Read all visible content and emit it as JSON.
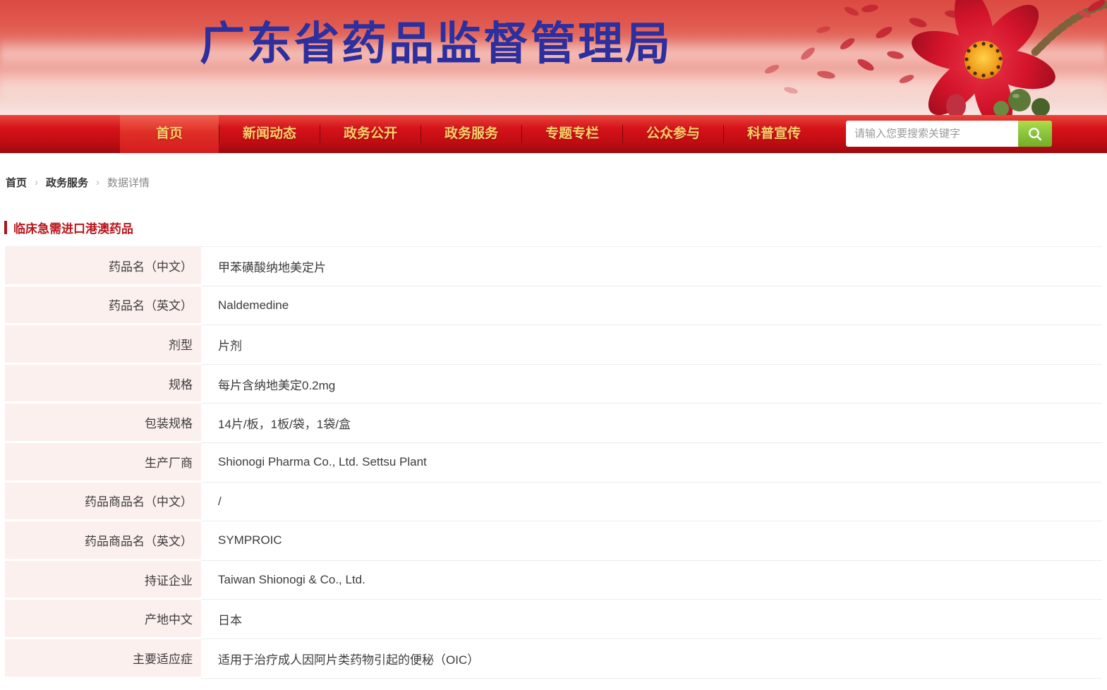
{
  "colors": {
    "nav_red": "#d5121a",
    "nav_active_red": "#e02f27",
    "nav_gold": "#fcd06e",
    "banner_title_blue": "#2c2f9d",
    "section_red": "#b9161c",
    "table_label_bg": "#fcf0ee",
    "search_button_green": "#8dc63f"
  },
  "banner": {
    "title": "广东省药品监督管理局"
  },
  "nav": {
    "items": [
      {
        "label": "首页"
      },
      {
        "label": "新闻动态"
      },
      {
        "label": "政务公开"
      },
      {
        "label": "政务服务"
      },
      {
        "label": "专题专栏"
      },
      {
        "label": "公众参与"
      },
      {
        "label": "科普宣传"
      }
    ],
    "search": {
      "placeholder": "请输入您要搜索关键字",
      "value": ""
    }
  },
  "breadcrumb": {
    "separator": "›",
    "items": [
      {
        "label": "首页"
      },
      {
        "label": "政务服务"
      },
      {
        "label": "数据详情"
      }
    ]
  },
  "section": {
    "title": "临床急需进口港澳药品"
  },
  "detail": {
    "rows": [
      {
        "label": "药品名（中文）",
        "value": "甲苯磺酸纳地美定片"
      },
      {
        "label": "药品名（英文）",
        "value": "Naldemedine"
      },
      {
        "label": "剂型",
        "value": "片剂"
      },
      {
        "label": "规格",
        "value": "每片含纳地美定0.2mg"
      },
      {
        "label": "包装规格",
        "value": "14片/板，1板/袋，1袋/盒"
      },
      {
        "label": "生产厂商",
        "value": "Shionogi Pharma Co., Ltd. Settsu Plant"
      },
      {
        "label": "药品商品名（中文）",
        "value": "/"
      },
      {
        "label": "药品商品名（英文）",
        "value": "SYMPROIC"
      },
      {
        "label": "持证企业",
        "value": "Taiwan Shionogi & Co., Ltd."
      },
      {
        "label": "产地中文",
        "value": "日本"
      },
      {
        "label": "主要适应症",
        "value": "适用于治疗成人因阿片类药物引起的便秘（OIC）"
      }
    ]
  }
}
